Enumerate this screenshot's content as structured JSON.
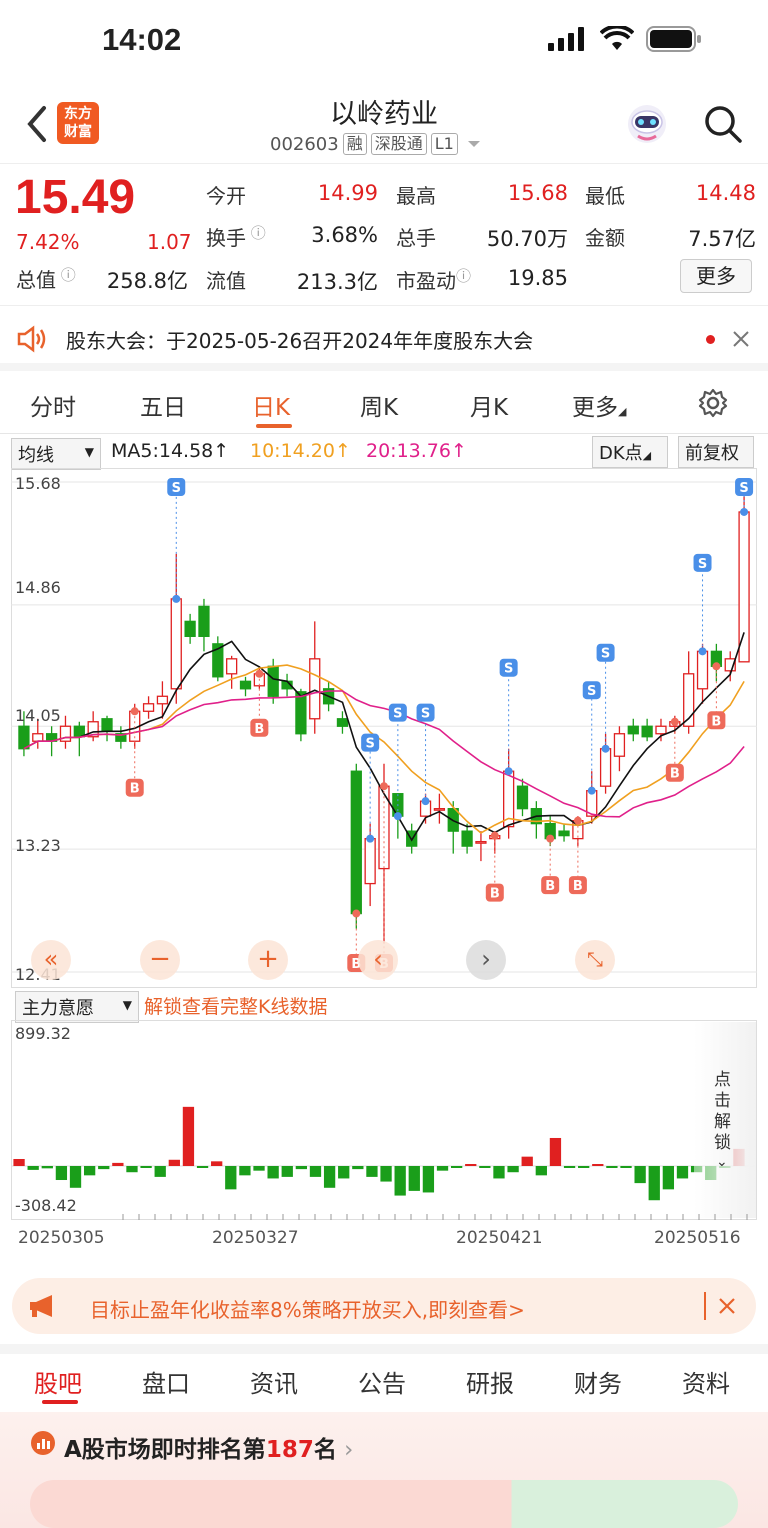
{
  "status": {
    "time": "14:02"
  },
  "header": {
    "logo_line1": "东方",
    "logo_line2": "财富",
    "name": "以岭药业",
    "code": "002603",
    "tags": [
      "融",
      "深股通",
      "L1"
    ]
  },
  "quote": {
    "price": "15.49",
    "pct": "7.42%",
    "chg": "1.07",
    "labels": [
      "今开",
      "最高",
      "最低",
      "换手",
      "总手",
      "金额",
      "总值",
      "流值",
      "市盈动"
    ],
    "open": "14.99",
    "high": "15.68",
    "low": "14.48",
    "turnover": "3.68%",
    "volume": "50.70万",
    "amount": "7.57亿",
    "mktcap": "258.8亿",
    "float": "213.3亿",
    "pe": "19.85",
    "more": "更多"
  },
  "notice": {
    "text": "股东大会：于2025-05-26召开2024年年度股东大会"
  },
  "tabs": [
    "分时",
    "五日",
    "日K",
    "周K",
    "月K",
    "更多"
  ],
  "ma": {
    "dropdown": "均线",
    "ma5": "MA5:14.58",
    "ma10": "10:14.20",
    "ma20": "20:13.76",
    "dk": "DK点",
    "fq": "前复权"
  },
  "chart_data": {
    "type": "candlestick",
    "y_ticks": [
      "15.68",
      "14.86",
      "14.05",
      "13.23",
      "12.41"
    ],
    "ylim": [
      12.41,
      15.68
    ],
    "x_labels": [
      "20250305",
      "20250327",
      "20250421",
      "20250516"
    ],
    "candles": [
      [
        14.05,
        13.9,
        14.15,
        13.85
      ],
      [
        13.95,
        14.0,
        14.1,
        13.9
      ],
      [
        14.0,
        13.95,
        14.05,
        13.85
      ],
      [
        13.95,
        14.05,
        14.12,
        13.9
      ],
      [
        14.05,
        13.98,
        14.08,
        13.85
      ],
      [
        13.98,
        14.08,
        14.15,
        13.95
      ],
      [
        14.1,
        14.02,
        14.12,
        13.95
      ],
      [
        14.0,
        13.95,
        14.05,
        13.9
      ],
      [
        13.95,
        14.15,
        14.2,
        13.9
      ],
      [
        14.15,
        14.2,
        14.25,
        14.1
      ],
      [
        14.2,
        14.25,
        14.35,
        14.1
      ],
      [
        14.3,
        14.9,
        15.2,
        14.2
      ],
      [
        14.75,
        14.65,
        14.8,
        14.6
      ],
      [
        14.85,
        14.65,
        14.9,
        14.55
      ],
      [
        14.6,
        14.38,
        14.65,
        14.35
      ],
      [
        14.4,
        14.5,
        14.52,
        14.3
      ],
      [
        14.35,
        14.3,
        14.38,
        14.25
      ],
      [
        14.32,
        14.4,
        14.45,
        14.3
      ],
      [
        14.45,
        14.25,
        14.5,
        14.2
      ],
      [
        14.35,
        14.3,
        14.4,
        14.25
      ],
      [
        14.28,
        14.0,
        14.3,
        13.95
      ],
      [
        14.1,
        14.5,
        14.75,
        14.0
      ],
      [
        14.3,
        14.2,
        14.35,
        14.15
      ],
      [
        14.1,
        14.05,
        14.15,
        14.0
      ],
      [
        13.75,
        12.8,
        13.8,
        12.7
      ],
      [
        13.0,
        13.3,
        13.4,
        12.85
      ],
      [
        13.1,
        13.65,
        13.8,
        12.6
      ],
      [
        13.6,
        13.45,
        13.6,
        13.3
      ],
      [
        13.35,
        13.25,
        13.4,
        13.2
      ],
      [
        13.45,
        13.55,
        13.6,
        13.4
      ],
      [
        13.5,
        13.5,
        13.6,
        13.4
      ],
      [
        13.5,
        13.35,
        13.55,
        13.2
      ],
      [
        13.35,
        13.25,
        13.4,
        13.2
      ],
      [
        13.28,
        13.28,
        13.35,
        13.15
      ],
      [
        13.3,
        13.32,
        13.35,
        13.2
      ],
      [
        13.38,
        13.75,
        13.9,
        13.3
      ],
      [
        13.65,
        13.5,
        13.7,
        13.45
      ],
      [
        13.5,
        13.4,
        13.55,
        13.3
      ],
      [
        13.4,
        13.3,
        13.45,
        13.25
      ],
      [
        13.35,
        13.32,
        13.4,
        13.28
      ],
      [
        13.3,
        13.42,
        13.45,
        13.25
      ],
      [
        13.45,
        13.62,
        13.75,
        13.4
      ],
      [
        13.65,
        13.9,
        14.0,
        13.6
      ],
      [
        13.85,
        14.0,
        14.05,
        13.75
      ],
      [
        14.05,
        14.0,
        14.1,
        13.95
      ],
      [
        14.05,
        13.98,
        14.1,
        13.95
      ],
      [
        14.0,
        14.05,
        14.1,
        13.95
      ],
      [
        14.05,
        14.08,
        14.12,
        14.0
      ],
      [
        14.05,
        14.4,
        14.55,
        14.0
      ],
      [
        14.3,
        14.55,
        14.6,
        14.2
      ],
      [
        14.55,
        14.45,
        14.6,
        14.35
      ],
      [
        14.42,
        14.5,
        14.55,
        14.35
      ],
      [
        14.48,
        15.48,
        15.68,
        14.48
      ]
    ]
  },
  "flow": {
    "dropdown": "主力意愿",
    "unlock": "解锁查看完整K线数据",
    "max": "899.32",
    "min": "-308.42",
    "side_text": "点击解锁",
    "values": [
      45,
      -25,
      -15,
      -90,
      -140,
      -60,
      -20,
      20,
      -40,
      -5,
      -70,
      40,
      380,
      -10,
      30,
      -150,
      -60,
      -30,
      -80,
      -70,
      -20,
      -70,
      -140,
      -80,
      -20,
      -70,
      -100,
      -190,
      -160,
      -170,
      -30,
      -10,
      5,
      -5,
      -80,
      -40,
      60,
      -60,
      180,
      -5,
      -10,
      10,
      -5,
      -10,
      -110,
      -220,
      -150,
      -80,
      -40,
      -90,
      -5,
      110
    ]
  },
  "banner": {
    "text": "目标止盈年化收益率8%策略开放买入,即刻查看>"
  },
  "bottom_tabs": [
    "股吧",
    "盘口",
    "资讯",
    "公告",
    "研报",
    "财务",
    "资料"
  ],
  "rank": {
    "prefix": "A股市场即时排名第",
    "num": "187",
    "suffix": "名"
  }
}
